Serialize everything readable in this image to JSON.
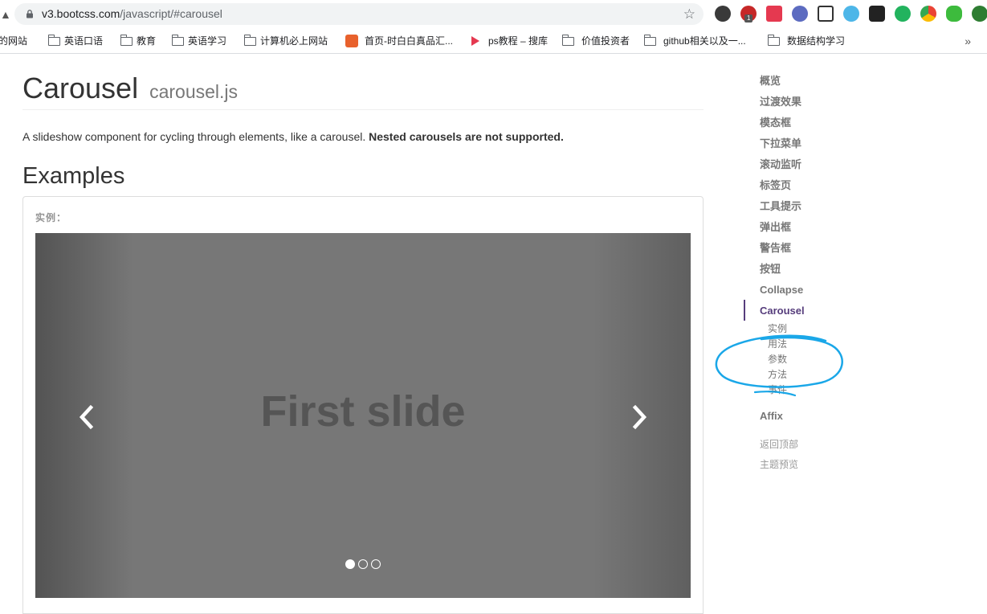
{
  "browser": {
    "url_host": "v3.bootcss.com",
    "url_path": "/javascript/#carousel",
    "bookmarks": [
      {
        "label": "玩的网站"
      },
      {
        "label": "英语口语"
      },
      {
        "label": "教育"
      },
      {
        "label": "英语学习"
      },
      {
        "label": "计算机必上网站"
      },
      {
        "label": "首页-时白白真品汇..."
      },
      {
        "label": "ps教程 – 搜库"
      },
      {
        "label": "价值投资者"
      },
      {
        "label": "github相关以及一..."
      },
      {
        "label": "数据结构学习"
      }
    ],
    "more_bookmarks": "»",
    "ext_badge": "1"
  },
  "page": {
    "title": "Carousel",
    "title_sub": "carousel.js",
    "lead": "A slideshow component for cycling through elements, like a carousel. ",
    "lead_bold": "Nested carousels are not supported.",
    "section_title": "Examples",
    "example_label": "实例：",
    "carousel": {
      "slide_text": "First slide",
      "indicators": 3,
      "active_index": 0
    }
  },
  "sidebar": {
    "items": [
      {
        "label": "概览"
      },
      {
        "label": "过渡效果"
      },
      {
        "label": "模态框"
      },
      {
        "label": "下拉菜单"
      },
      {
        "label": "滚动监听"
      },
      {
        "label": "标签页"
      },
      {
        "label": "工具提示"
      },
      {
        "label": "弹出框"
      },
      {
        "label": "警告框"
      },
      {
        "label": "按钮"
      },
      {
        "label": "Collapse"
      },
      {
        "label": "Carousel"
      }
    ],
    "active_label": "Carousel",
    "sub_items": [
      {
        "label": "实例"
      },
      {
        "label": "用法"
      },
      {
        "label": "参数"
      },
      {
        "label": "方法"
      },
      {
        "label": "事件"
      }
    ],
    "affix": "Affix",
    "back_to_top": "返回顶部",
    "theme_preview": "主题预览"
  },
  "colors": {
    "active_purple": "#563d7c",
    "annotation_blue": "#1aa7e8"
  }
}
